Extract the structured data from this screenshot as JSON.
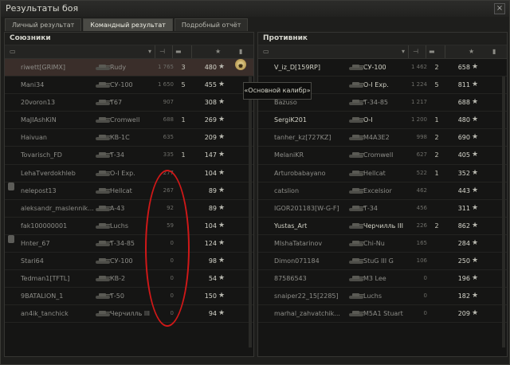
{
  "window": {
    "title": "Результаты боя",
    "close_glyph": "×"
  },
  "tabs": [
    {
      "label": "Личный результат",
      "active": false
    },
    {
      "label": "Командный результат",
      "active": true
    },
    {
      "label": "Подробный отчёт",
      "active": false
    }
  ],
  "allies": {
    "title": "Союзники",
    "rows": [
      {
        "player": "riwett[GRIMX]",
        "tank": "Rudy",
        "damage": "1 765",
        "kills": "3",
        "xp": "480",
        "alive": false,
        "pinned": false,
        "highlight": true
      },
      {
        "player": "Mani34",
        "tank": "СУ-100",
        "damage": "1 650",
        "kills": "5",
        "xp": "455",
        "alive": false,
        "pinned": false,
        "highlight": false
      },
      {
        "player": "20voron13",
        "tank": "T67",
        "damage": "907",
        "kills": "",
        "xp": "308",
        "alive": false,
        "pinned": false,
        "highlight": false
      },
      {
        "player": "MaJIAshKiN",
        "tank": "Cromwell",
        "damage": "688",
        "kills": "1",
        "xp": "269",
        "alive": false,
        "pinned": false,
        "highlight": false
      },
      {
        "player": "Haivuan",
        "tank": "КВ-1С",
        "damage": "635",
        "kills": "",
        "xp": "209",
        "alive": false,
        "pinned": false,
        "highlight": false
      },
      {
        "player": "Tovarisch_FD",
        "tank": "Т-34",
        "damage": "335",
        "kills": "1",
        "xp": "147",
        "alive": false,
        "pinned": false,
        "highlight": false
      },
      {
        "player": "LehaTverdokhleb",
        "tank": "O-I Exp.",
        "damage": "277",
        "kills": "",
        "xp": "104",
        "alive": false,
        "pinned": false,
        "highlight": false
      },
      {
        "player": "nelepost13",
        "tank": "Hellcat",
        "damage": "267",
        "kills": "",
        "xp": "89",
        "alive": false,
        "pinned": true,
        "highlight": false
      },
      {
        "player": "aleksandr_maslennik...",
        "tank": "A-43",
        "damage": "92",
        "kills": "",
        "xp": "89",
        "alive": false,
        "pinned": false,
        "highlight": false
      },
      {
        "player": "fak100000001",
        "tank": "Luchs",
        "damage": "59",
        "kills": "",
        "xp": "104",
        "alive": false,
        "pinned": false,
        "highlight": false
      },
      {
        "player": "Hnter_67",
        "tank": "Т-34-85",
        "damage": "0",
        "kills": "",
        "xp": "124",
        "alive": false,
        "pinned": true,
        "highlight": false
      },
      {
        "player": "Stari64",
        "tank": "СУ-100",
        "damage": "0",
        "kills": "",
        "xp": "98",
        "alive": false,
        "pinned": false,
        "highlight": false
      },
      {
        "player": "Tedman1[TFTL]",
        "tank": "КВ-2",
        "damage": "0",
        "kills": "",
        "xp": "54",
        "alive": false,
        "pinned": false,
        "highlight": false
      },
      {
        "player": "9BATALION_1",
        "tank": "Т-50",
        "damage": "0",
        "kills": "",
        "xp": "150",
        "alive": false,
        "pinned": false,
        "highlight": false
      },
      {
        "player": "an4ik_tanchick",
        "tank": "Черчилль III",
        "damage": "0",
        "kills": "",
        "xp": "94",
        "alive": false,
        "pinned": false,
        "highlight": false
      }
    ]
  },
  "enemies": {
    "title": "Противник",
    "rows": [
      {
        "player": "V_iz_D[159RP]",
        "tank": "СУ-100",
        "damage": "1 462",
        "kills": "2",
        "xp": "658",
        "alive": true,
        "pinned": false,
        "highlight": false
      },
      {
        "player": "",
        "tank": "O-I Exp.",
        "damage": "1 224",
        "kills": "5",
        "xp": "811",
        "alive": true,
        "pinned": false,
        "highlight": false
      },
      {
        "player": "Bazuso",
        "tank": "Т-34-85",
        "damage": "1 217",
        "kills": "",
        "xp": "688",
        "alive": false,
        "pinned": false,
        "highlight": false
      },
      {
        "player": "SergiK201",
        "tank": "O-I",
        "damage": "1 200",
        "kills": "1",
        "xp": "480",
        "alive": true,
        "pinned": false,
        "highlight": false
      },
      {
        "player": "tanher_kz[727KZ]",
        "tank": "M4A3E2",
        "damage": "998",
        "kills": "2",
        "xp": "690",
        "alive": false,
        "pinned": false,
        "highlight": false
      },
      {
        "player": "MelaniKR",
        "tank": "Cromwell",
        "damage": "627",
        "kills": "2",
        "xp": "405",
        "alive": false,
        "pinned": false,
        "highlight": false
      },
      {
        "player": "Arturobabayano",
        "tank": "Hellcat",
        "damage": "522",
        "kills": "1",
        "xp": "352",
        "alive": false,
        "pinned": false,
        "highlight": false
      },
      {
        "player": "catslion",
        "tank": "Excelsior",
        "damage": "462",
        "kills": "",
        "xp": "443",
        "alive": false,
        "pinned": false,
        "highlight": false
      },
      {
        "player": "IGOR201183[W-G-F]",
        "tank": "Т-34",
        "damage": "456",
        "kills": "",
        "xp": "311",
        "alive": false,
        "pinned": false,
        "highlight": false
      },
      {
        "player": "Yustas_Art",
        "tank": "Черчилль III",
        "damage": "226",
        "kills": "2",
        "xp": "862",
        "alive": true,
        "pinned": false,
        "highlight": false
      },
      {
        "player": "MIshaTatarinov",
        "tank": "Chi-Nu",
        "damage": "165",
        "kills": "",
        "xp": "284",
        "alive": false,
        "pinned": false,
        "highlight": false
      },
      {
        "player": "Dimon071184",
        "tank": "StuG III G",
        "damage": "106",
        "kills": "",
        "xp": "250",
        "alive": false,
        "pinned": false,
        "highlight": false
      },
      {
        "player": "87586543",
        "tank": "M3 Lee",
        "damage": "0",
        "kills": "",
        "xp": "196",
        "alive": false,
        "pinned": false,
        "highlight": false
      },
      {
        "player": "snaiper22_15[2285]",
        "tank": "Luchs",
        "damage": "0",
        "kills": "",
        "xp": "182",
        "alive": false,
        "pinned": false,
        "highlight": false
      },
      {
        "player": "marhal_zahvatchik...",
        "tank": "M5A1 Stuart",
        "damage": "0",
        "kills": "",
        "xp": "209",
        "alive": false,
        "pinned": false,
        "highlight": false
      }
    ]
  },
  "star_glyph": "★",
  "tooltip": "«Основной калибр»",
  "colors": {
    "highlight_row": "#3a2e2a",
    "annotation_circle": "#d01818",
    "alive_text": "#d4d4c8",
    "dead_text": "#8d8d88"
  },
  "icons": {
    "header_icons": [
      "chat-icon",
      "sort-chevron-icon",
      "damage-icon",
      "kills-icon",
      "xp-icon",
      "medal-icon"
    ],
    "row_medal": "main-caliber-medal-icon"
  }
}
